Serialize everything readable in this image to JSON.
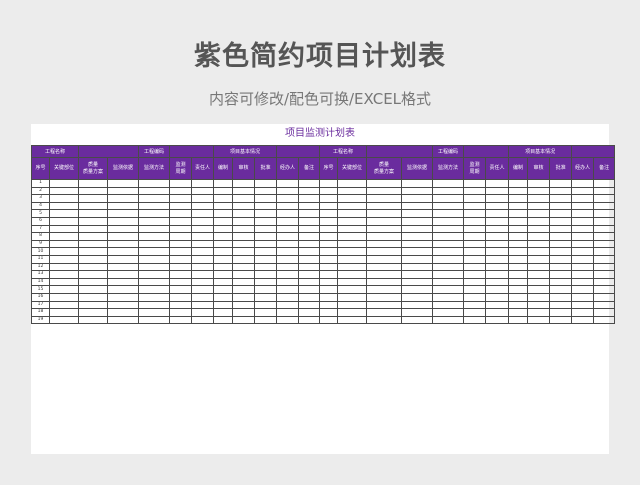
{
  "page": {
    "title": "紫色简约项目计划表",
    "subtitle": "内容可修改/配色可换/EXCEL格式"
  },
  "sheet": {
    "title": "项目监测计划表",
    "header_row1": [
      "工程名称",
      "",
      "工程编码",
      "",
      "项目基本情况",
      "",
      "工程名称",
      "",
      "工程编码",
      "",
      "项目基本情况",
      ""
    ],
    "header_row2": [
      "序号",
      "关键部位",
      "质量\n质量方案",
      "监测依据",
      "监测方法",
      "监测\n周期",
      "责任人",
      "编制",
      "审核",
      "批准",
      "经办人",
      "备注",
      "序号",
      "关键部位",
      "质量\n质量方案",
      "监测依据",
      "监测方法",
      "监测\n周期",
      "责任人",
      "编制",
      "审核",
      "批准",
      "经办人",
      "备注"
    ],
    "row_numbers": [
      "1",
      "2",
      "3",
      "4",
      "5",
      "6",
      "7",
      "8",
      "9",
      "10",
      "11",
      "12",
      "13",
      "14",
      "15",
      "16",
      "17",
      "18",
      "19"
    ]
  },
  "colors": {
    "header_bg": "#6a2c9e",
    "header_text": "#ffffff",
    "sheet_title": "#6a2c9e",
    "page_bg": "#ececec"
  }
}
